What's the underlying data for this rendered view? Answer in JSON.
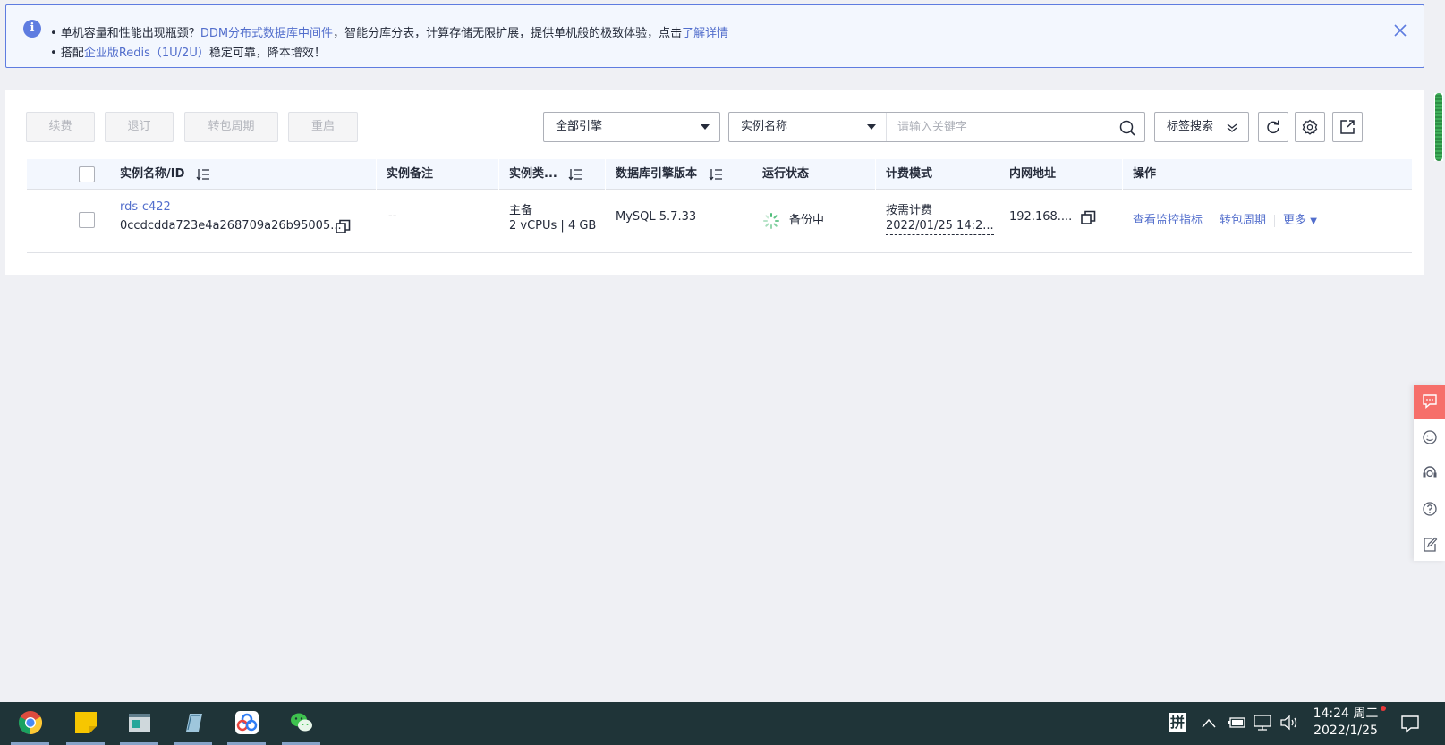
{
  "notice": {
    "line1_prefix": "• 单机容量和性能出现瓶颈？",
    "line1_link": "DDM分布式数据库中间件",
    "line1_middle": "，智能分库分表，计算存储无限扩展，提供单机般的极致体验，点击",
    "line1_link2": "了解详情",
    "line2_prefix": "• 搭配",
    "line2_link": "企业版Redis（1U/2U）",
    "line2_suffix": "稳定可靠，降本增效！"
  },
  "toolbar": {
    "renew": "续费",
    "unsubscribe": "退订",
    "to_yearly": "转包周期",
    "restart": "重启",
    "engine_select": "全部引擎",
    "filter_select": "实例名称",
    "search_placeholder": "请输入关键字",
    "tag_search": "标签搜索"
  },
  "table": {
    "headers": {
      "name": "实例名称/ID",
      "remark": "实例备注",
      "type": "实例类...",
      "engine": "数据库引擎版本",
      "status": "运行状态",
      "billing": "计费模式",
      "address": "内网地址",
      "actions": "操作"
    },
    "rows": [
      {
        "name": "rds-c422",
        "id": "0ccdcdda723e4a268709a26b95005...",
        "remark": "--",
        "type_main": "主备",
        "type_spec": "2 vCPUs | 4 GB",
        "engine": "MySQL 5.7.33",
        "status": "备份中",
        "billing": "按需计费",
        "billing_time": "2022/01/25 14:2...",
        "address": "192.168....",
        "action_monitor": "查看监控指标",
        "action_yearly": "转包周期",
        "action_more": "更多"
      }
    ]
  },
  "taskbar": {
    "ime": "拼",
    "time": "14:24 周二",
    "date": "2022/1/25"
  },
  "colors": {
    "accent": "#5e7ce0",
    "link": "#526ecc",
    "taskbar": "#1f3438",
    "float_active": "#f66f6a"
  }
}
